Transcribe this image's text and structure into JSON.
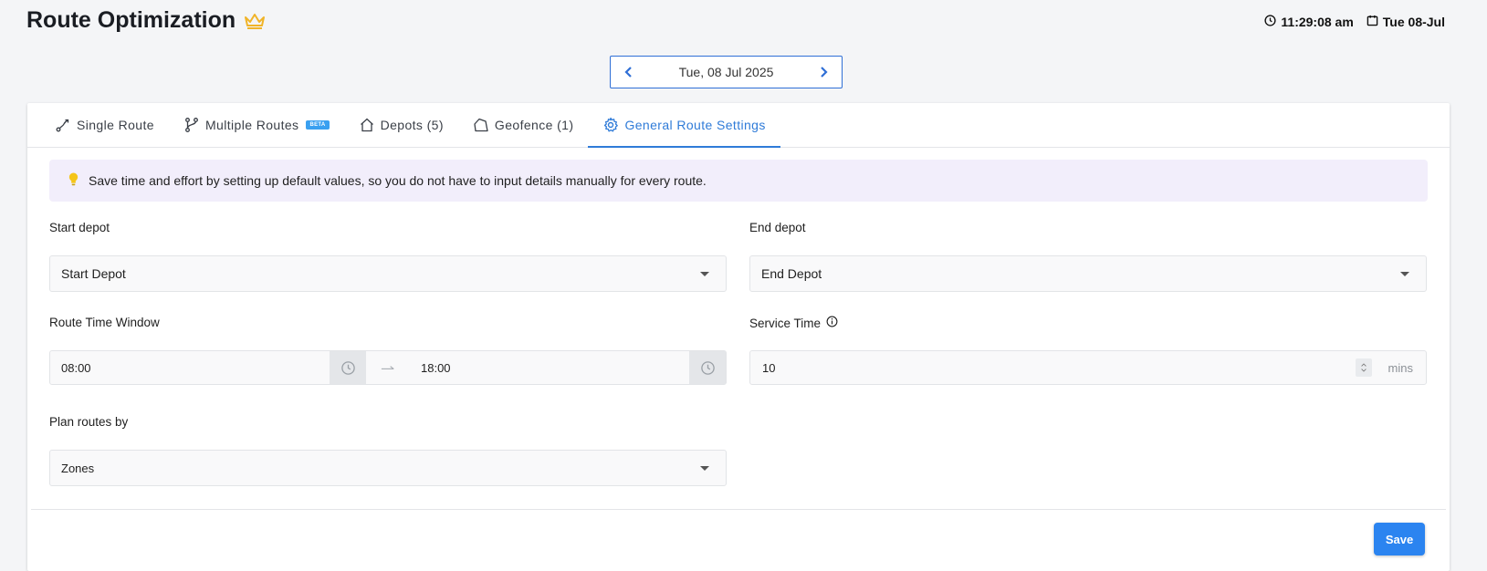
{
  "header": {
    "title": "Route Optimization",
    "time": "11:29:08 am",
    "date": "Tue 08-Jul"
  },
  "date_nav": {
    "current_date": "Tue, 08 Jul 2025"
  },
  "tabs": [
    {
      "label": "Single Route",
      "icon": "route-icon",
      "active": false
    },
    {
      "label": "Multiple Routes",
      "icon": "branch-icon",
      "badge": "BETA",
      "active": false
    },
    {
      "label": "Depots (5)",
      "icon": "home-icon",
      "active": false
    },
    {
      "label": "Geofence (1)",
      "icon": "polygon-icon",
      "active": false
    },
    {
      "label": "General Route Settings",
      "icon": "gear-icon",
      "active": true
    }
  ],
  "tip": {
    "text": "Save time and effort by setting up default values, so you do not have to input details manually for every route."
  },
  "form": {
    "start_depot": {
      "label": "Start depot",
      "value": "Start Depot"
    },
    "end_depot": {
      "label": "End depot",
      "value": "End Depot"
    },
    "route_time_window": {
      "label": "Route Time Window",
      "start": "08:00",
      "end": "18:00"
    },
    "service_time": {
      "label": "Service Time",
      "value": "10",
      "unit": "mins"
    },
    "plan_routes_by": {
      "label": "Plan routes by",
      "value": "Zones"
    }
  },
  "actions": {
    "save_label": "Save"
  },
  "colors": {
    "accent": "#2f7bd8",
    "save_button": "#2b84f0",
    "tip_background": "#f2eefb",
    "crown": "#f0b429",
    "bulb": "#f5c518"
  }
}
